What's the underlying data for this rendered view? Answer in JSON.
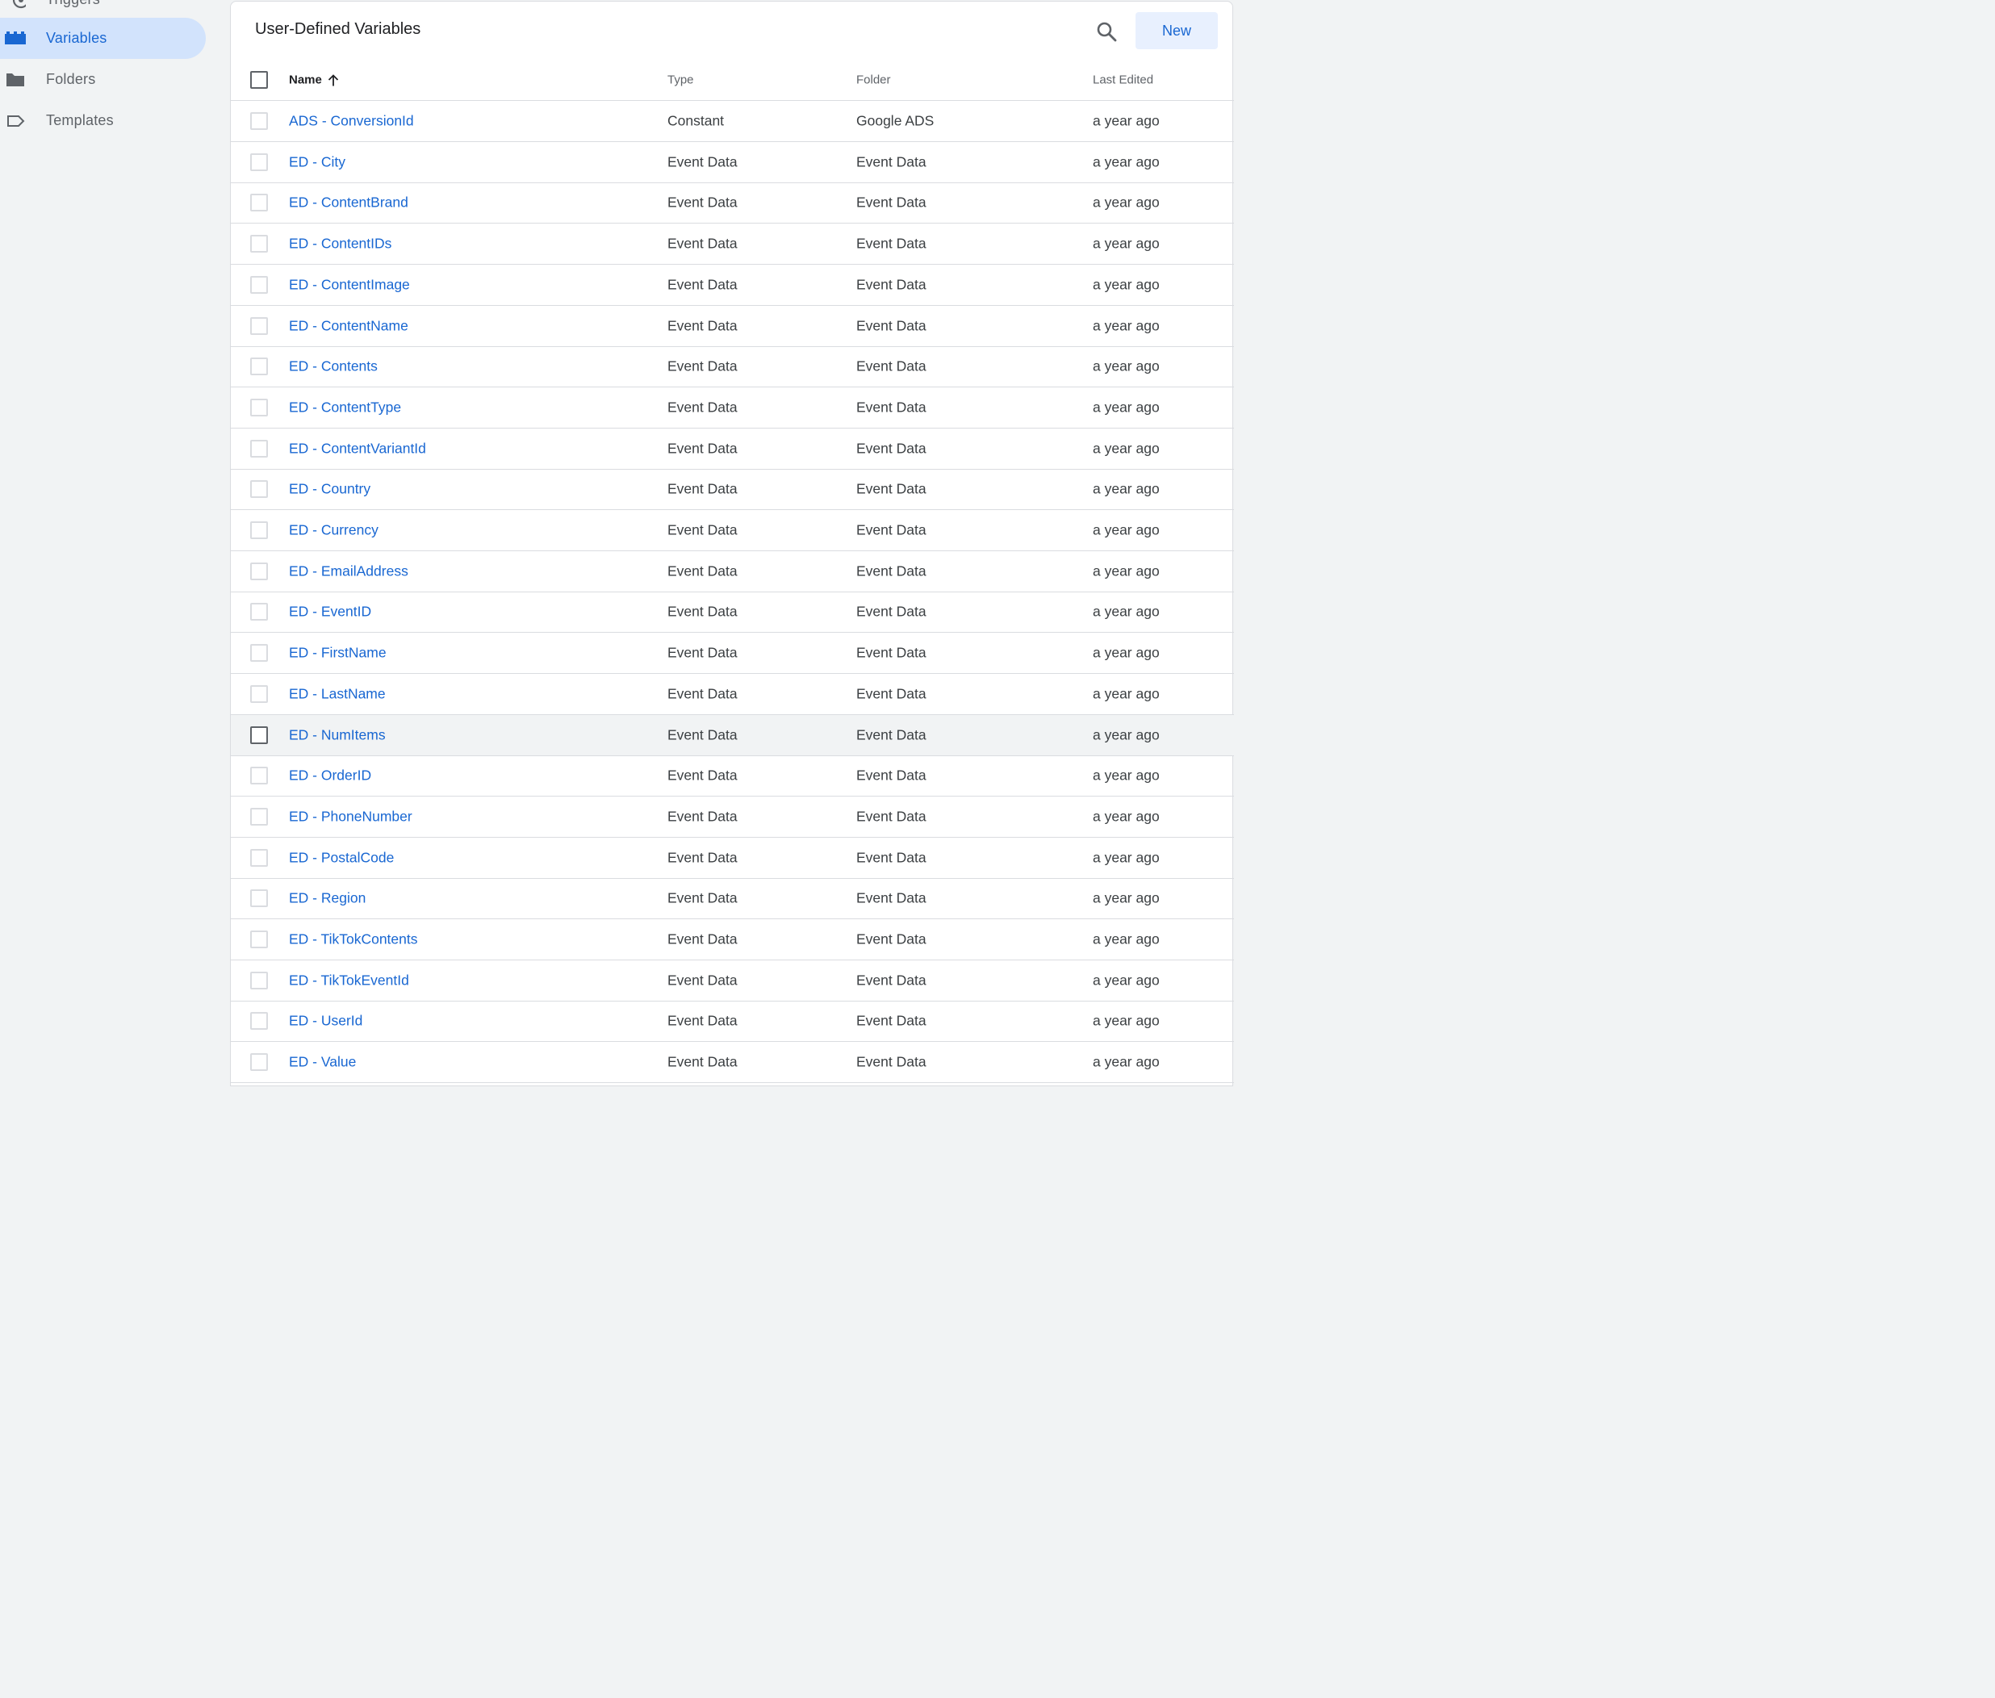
{
  "sidebar": {
    "items": [
      {
        "label": "Triggers",
        "icon": "triggers-icon",
        "active": false
      },
      {
        "label": "Variables",
        "icon": "variables-icon",
        "active": true
      },
      {
        "label": "Folders",
        "icon": "folder-icon",
        "active": false
      },
      {
        "label": "Templates",
        "icon": "templates-icon",
        "active": false
      }
    ]
  },
  "panel": {
    "title": "User-Defined Variables",
    "new_label": "New",
    "search_icon": "search-icon"
  },
  "table": {
    "columns": {
      "name": "Name",
      "type": "Type",
      "folder": "Folder",
      "last_edited": "Last Edited"
    },
    "sort": {
      "column": "name",
      "direction": "ascending",
      "icon": "arrow-up-icon"
    },
    "rows": [
      {
        "name": "ADS - ConversionId",
        "type": "Constant",
        "folder": "Google ADS",
        "edited": "a year ago"
      },
      {
        "name": "ED - City",
        "type": "Event Data",
        "folder": "Event Data",
        "edited": "a year ago"
      },
      {
        "name": "ED - ContentBrand",
        "type": "Event Data",
        "folder": "Event Data",
        "edited": "a year ago"
      },
      {
        "name": "ED - ContentIDs",
        "type": "Event Data",
        "folder": "Event Data",
        "edited": "a year ago"
      },
      {
        "name": "ED - ContentImage",
        "type": "Event Data",
        "folder": "Event Data",
        "edited": "a year ago"
      },
      {
        "name": "ED - ContentName",
        "type": "Event Data",
        "folder": "Event Data",
        "edited": "a year ago"
      },
      {
        "name": "ED - Contents",
        "type": "Event Data",
        "folder": "Event Data",
        "edited": "a year ago"
      },
      {
        "name": "ED - ContentType",
        "type": "Event Data",
        "folder": "Event Data",
        "edited": "a year ago"
      },
      {
        "name": "ED - ContentVariantId",
        "type": "Event Data",
        "folder": "Event Data",
        "edited": "a year ago"
      },
      {
        "name": "ED - Country",
        "type": "Event Data",
        "folder": "Event Data",
        "edited": "a year ago"
      },
      {
        "name": "ED - Currency",
        "type": "Event Data",
        "folder": "Event Data",
        "edited": "a year ago"
      },
      {
        "name": "ED - EmailAddress",
        "type": "Event Data",
        "folder": "Event Data",
        "edited": "a year ago"
      },
      {
        "name": "ED - EventID",
        "type": "Event Data",
        "folder": "Event Data",
        "edited": "a year ago"
      },
      {
        "name": "ED - FirstName",
        "type": "Event Data",
        "folder": "Event Data",
        "edited": "a year ago"
      },
      {
        "name": "ED - LastName",
        "type": "Event Data",
        "folder": "Event Data",
        "edited": "a year ago"
      },
      {
        "name": "ED - NumItems",
        "type": "Event Data",
        "folder": "Event Data",
        "edited": "a year ago"
      },
      {
        "name": "ED - OrderID",
        "type": "Event Data",
        "folder": "Event Data",
        "edited": "a year ago"
      },
      {
        "name": "ED - PhoneNumber",
        "type": "Event Data",
        "folder": "Event Data",
        "edited": "a year ago"
      },
      {
        "name": "ED - PostalCode",
        "type": "Event Data",
        "folder": "Event Data",
        "edited": "a year ago"
      },
      {
        "name": "ED - Region",
        "type": "Event Data",
        "folder": "Event Data",
        "edited": "a year ago"
      },
      {
        "name": "ED - TikTokContents",
        "type": "Event Data",
        "folder": "Event Data",
        "edited": "a year ago"
      },
      {
        "name": "ED - TikTokEventId",
        "type": "Event Data",
        "folder": "Event Data",
        "edited": "a year ago"
      },
      {
        "name": "ED - UserId",
        "type": "Event Data",
        "folder": "Event Data",
        "edited": "a year ago"
      },
      {
        "name": "ED - Value",
        "type": "Event Data",
        "folder": "Event Data",
        "edited": "a year ago"
      }
    ]
  },
  "colors": {
    "accent": "#1967d2",
    "active_nav_bg": "#d2e3fc",
    "new_button_bg": "#e8f0fe",
    "background": "#f1f3f4",
    "border": "#dadce0"
  }
}
